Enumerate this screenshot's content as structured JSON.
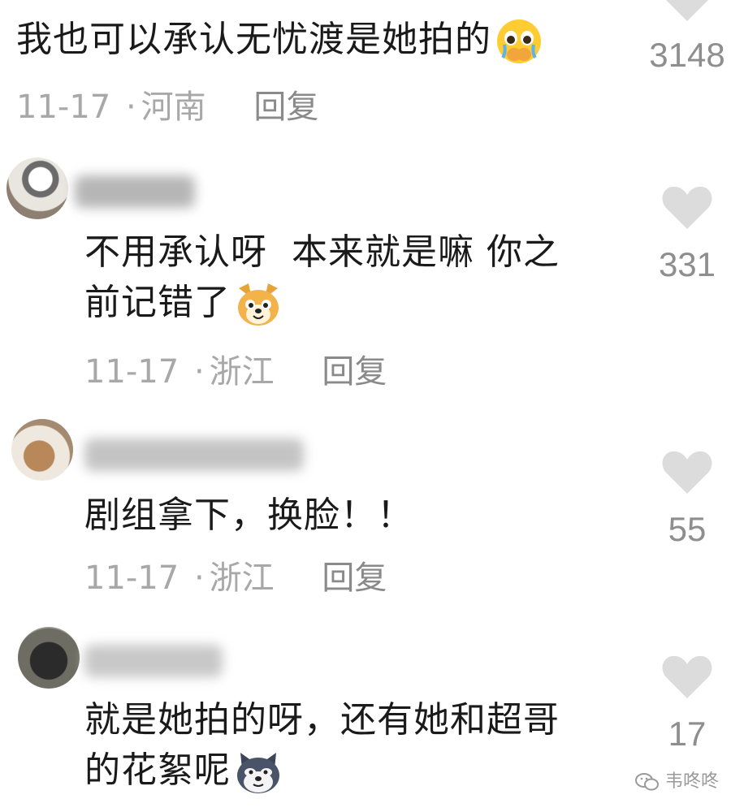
{
  "comments": [
    {
      "text": "我也可以承认无忧渡是她拍的",
      "emoji": "crying-hands-emoji",
      "date": "11-17",
      "dot": "·",
      "location": "河南",
      "reply_label": "回复",
      "likes": "3148"
    },
    {
      "text_line1": "不用承认呀  本来就是嘛 你之",
      "text_line2": "前记错了",
      "emoji": "dog-face-emoji",
      "date": "11-17",
      "dot": "·",
      "location": "浙江",
      "reply_label": "回复",
      "likes": "331"
    },
    {
      "text": "剧组拿下，换脸！！",
      "date": "11-17",
      "dot": "·",
      "location": "浙江",
      "reply_label": "回复",
      "likes": "55"
    },
    {
      "text_line1": "就是她拍的呀，还有她和超哥",
      "text_line2": "的花絮呢",
      "emoji": "husky-face-emoji",
      "likes": "17"
    }
  ],
  "watermark": {
    "icon": "wechat-icon",
    "text": "韦咚咚"
  },
  "colors": {
    "text": "#1a1a1a",
    "meta": "#a8a8a8",
    "heart": "#dcdcdc",
    "count": "#8e8e8e"
  }
}
